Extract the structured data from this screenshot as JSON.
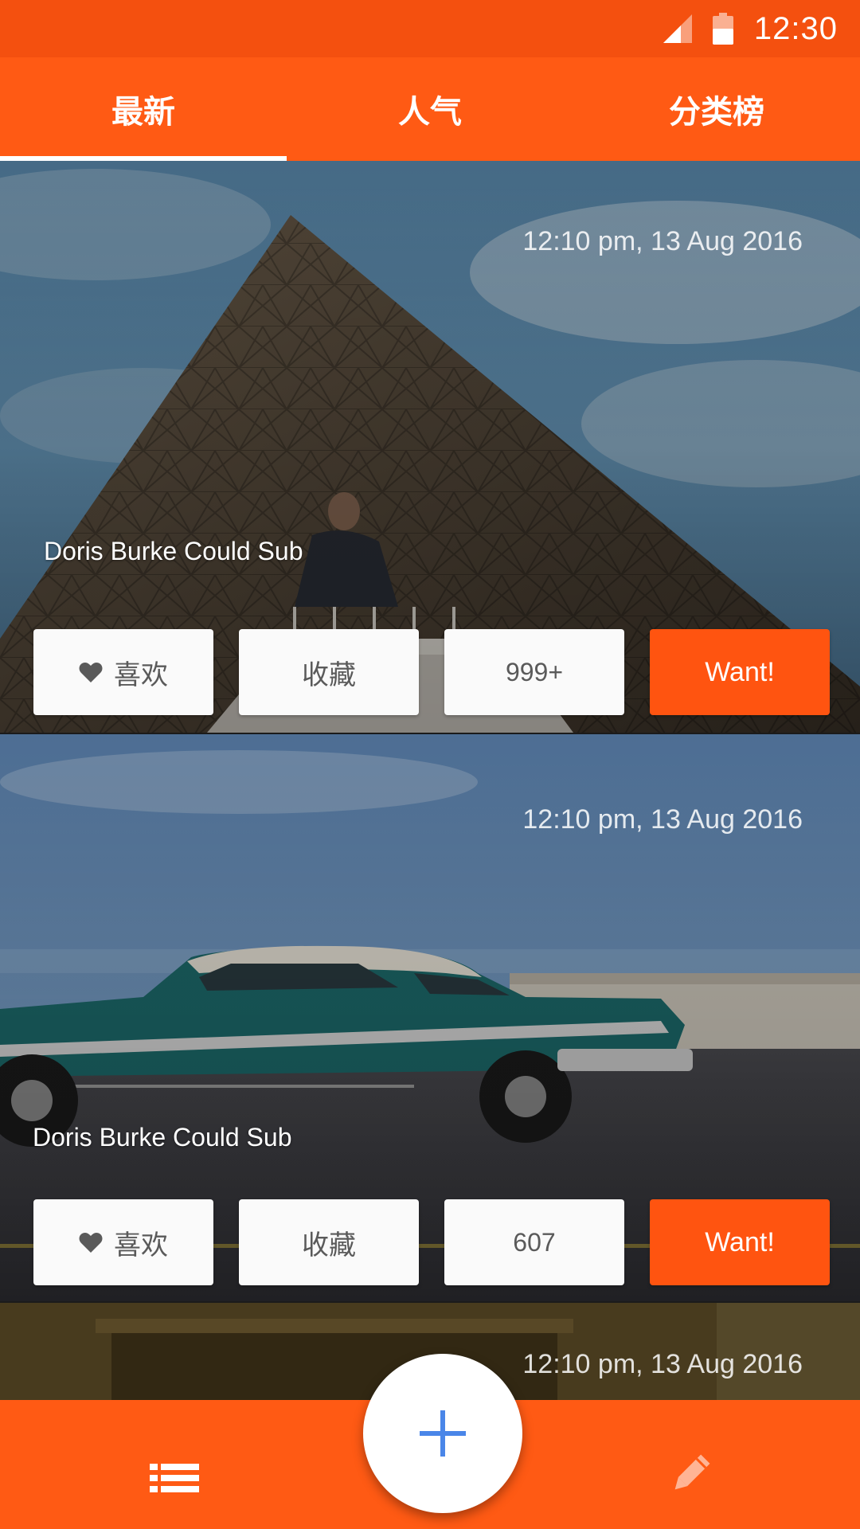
{
  "status_bar": {
    "time": "12:30"
  },
  "tabs": [
    {
      "label": "最新",
      "active": true
    },
    {
      "label": "人气",
      "active": false
    },
    {
      "label": "分类榜",
      "active": false
    }
  ],
  "cards": [
    {
      "time": "12:10 pm, 13 Aug 2016",
      "title": "Doris Burke Could Sub",
      "like_label": "喜欢",
      "collect_label": "收藏",
      "count": "999+",
      "want_label": "Want!"
    },
    {
      "time": "12:10 pm, 13 Aug 2016",
      "title": "Doris Burke Could Sub",
      "like_label": "喜欢",
      "collect_label": "收藏",
      "count": "607",
      "want_label": "Want!"
    },
    {
      "time": "12:10 pm, 13 Aug 2016"
    }
  ],
  "colors": {
    "accent": "#ff5a14",
    "status_bar": "#f4500f",
    "fab_icon": "#4a86e8"
  },
  "icons": {
    "signal": "signal-icon",
    "battery": "battery-icon",
    "like": "heart-icon",
    "list": "list-icon",
    "add": "plus-icon",
    "edit": "pencil-icon"
  }
}
